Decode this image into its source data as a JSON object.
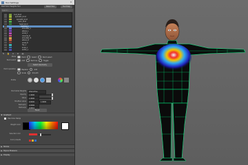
{
  "window": {
    "title": "Tool Settings"
  },
  "toolbar": {
    "label": "Paint Skin Weights Tool",
    "reset_label": "Reset Tool",
    "help_label": "Tool Help"
  },
  "influences": {
    "search_placeholder": "Search...",
    "items": [
      {
        "label": "root_bind",
        "color": "#7a9a3a"
      },
      {
        "label": "spine01_bind",
        "color": "#9ab13a"
      },
      {
        "label": "spine02_bind",
        "color": "#c8c03a"
      },
      {
        "label": "neck_bind",
        "color": "#4aa84a"
      },
      {
        "label": "head_bind",
        "color": "#3a8a3a"
      },
      {
        "label": "clavicle_L",
        "color": "#5a9ac8",
        "selected": true
      },
      {
        "label": "shoulder_L",
        "color": "#6a6ad0"
      },
      {
        "label": "elbow_L",
        "color": "#8a4ad0"
      },
      {
        "label": "wrist_L",
        "color": "#b04ab0"
      },
      {
        "label": "clavicle_R",
        "color": "#d04a8a"
      },
      {
        "label": "shoulder_R",
        "color": "#d0a04a"
      },
      {
        "label": "elbow_R",
        "color": "#c05a3a"
      },
      {
        "label": "wrist_R",
        "color": "#8a3a3a"
      },
      {
        "label": "hip_L",
        "color": "#3ab0b0"
      },
      {
        "label": "knee_L",
        "color": "#3a7ab0"
      },
      {
        "label": "ankle_L",
        "color": "#4a4ab0"
      }
    ]
  },
  "mode": {
    "label": "Mode",
    "options": [
      "Paint",
      "Select",
      "Paint select"
    ],
    "selected": 0
  },
  "paint_select": {
    "label": "Paint select",
    "options": [
      "Add",
      "Remove",
      "Toggle"
    ],
    "selected": 0
  },
  "paint_operation": {
    "label": "Paint operation",
    "options": [
      "Replace",
      "Add",
      "Scale",
      "Smooth"
    ],
    "selected": 0
  },
  "buttons": {
    "select_geometry": "Select Geometry",
    "flood": "Flood"
  },
  "profile": {
    "label": "Profile"
  },
  "fields": {
    "normalize": {
      "label": "Normalize Weights",
      "value": "Interactive"
    },
    "opacity": {
      "label": "Opacity",
      "value": "1.0000"
    },
    "value": {
      "label": "Value",
      "value": "1.0000"
    },
    "min_max": {
      "label": "Min/Max value",
      "min": "0.0000",
      "max": "1.0000"
    },
    "radius_u": {
      "label": "Radius(U)",
      "value": "0.0500"
    },
    "radius_l": {
      "label": "Radius(L)",
      "value": "0.0010"
    }
  },
  "gradient_section": {
    "title": "Gradient",
    "use_color_ramp": "Use Color Ramp",
    "weight_color": "Weight Color",
    "selected_color": "Selected color",
    "color_presets": "Color presets"
  },
  "sections": [
    "Stroke",
    "Stylus Pressure",
    "Display"
  ],
  "colors": {
    "selection": "#5f8fc4",
    "wireframe": "#00ff88",
    "panel": "#444444"
  }
}
